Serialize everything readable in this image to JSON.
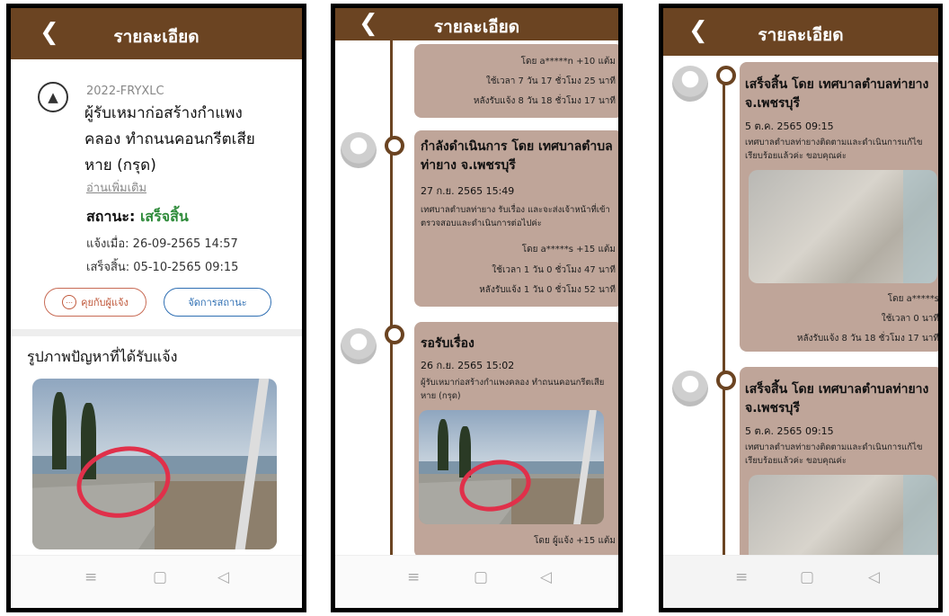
{
  "header": {
    "title": "รายละเอียด",
    "back_icon": "chevron-left-icon"
  },
  "colors": {
    "header": "#6b4422",
    "status_done": "#2e8b3a",
    "card": "#bfa599"
  },
  "screen1": {
    "report_code": "2022-FRYXLC",
    "report_title": "ผู้รับเหมาก่อสร้างกำแพงคลอง ทำถนนคอนกรีตเสียหาย (กรุด)",
    "read_more": "อ่านเพิ่มเติม",
    "status_label": "สถานะ:",
    "status_value": "เสร็จสิ้น",
    "reported_at": "แจ้งเมื่อ: 26-09-2565 14:57",
    "finished_at": "เสร็จสิ้น: 05-10-2565 09:15",
    "chat_button": "คุยกับผู้แจ้ง",
    "manage_button": "จัดการสถานะ",
    "images_title": "รูปภาพปัญหาที่ได้รับแจ้ง"
  },
  "screen2": {
    "top_card": {
      "by": "โดย a*****n +10 แต้ม",
      "time_used": "ใช้เวลา 7 วัน 17 ชั่วโมง 25 นาที",
      "after_report": "หลังรับแจ้ง 8 วัน 18 ชั่วโมง 17 นาที"
    },
    "card2": {
      "title": "กำลังดำเนินการ โดย เทศบาลตำบลท่ายาง จ.เพชรบุรี",
      "date": "27 ก.ย. 2565 15:49",
      "text": "เทศบาลตำบลท่ายาง รับเรื่อง และจะส่งเจ้าหน้าที่เข้าตรวจสอบและดำเนินการต่อไปค่ะ",
      "by": "โดย a*****s +15 แต้ม",
      "time_used": "ใช้เวลา 1 วัน 0 ชั่วโมง 47 นาที",
      "after_report": "หลังรับแจ้ง 1 วัน 0 ชั่วโมง 52 นาที"
    },
    "card3": {
      "title": "รอรับเรื่อง",
      "date": "26 ก.ย. 2565 15:02",
      "text": "ผู้รับเหมาก่อสร้างกำแพงคลอง ทำถนนคอนกรีตเสียหาย (กรุด)",
      "by": "โดย ผู้แจ้ง +15 แต้ม"
    }
  },
  "screen3": {
    "card1": {
      "title": "เสร็จสิ้น โดย เทศบาลตำบลท่ายาง จ.เพชรบุรี",
      "date": "5 ต.ค. 2565 09:15",
      "text": "เทศบาลตำบลท่ายางติดตามและดำเนินการแก้ไขเรียบร้อยแล้วค่ะ ขอบคุณค่ะ",
      "by": "โดย a*****s",
      "time_used": "ใช้เวลา 0 นาที",
      "after_report": "หลังรับแจ้ง 8 วัน 18 ชั่วโมง 17 นาที"
    },
    "card2": {
      "title": "เสร็จสิ้น โดย เทศบาลตำบลท่ายาง จ.เพชรบุรี",
      "date": "5 ต.ค. 2565 09:15",
      "text": "เทศบาลตำบลท่ายางติดตามและดำเนินการแก้ไขเรียบร้อยแล้วค่ะ ขอบคุณค่ะ"
    }
  },
  "navbar": {
    "menu_icon": "≡",
    "home_icon": "▢",
    "back_icon": "◁"
  }
}
